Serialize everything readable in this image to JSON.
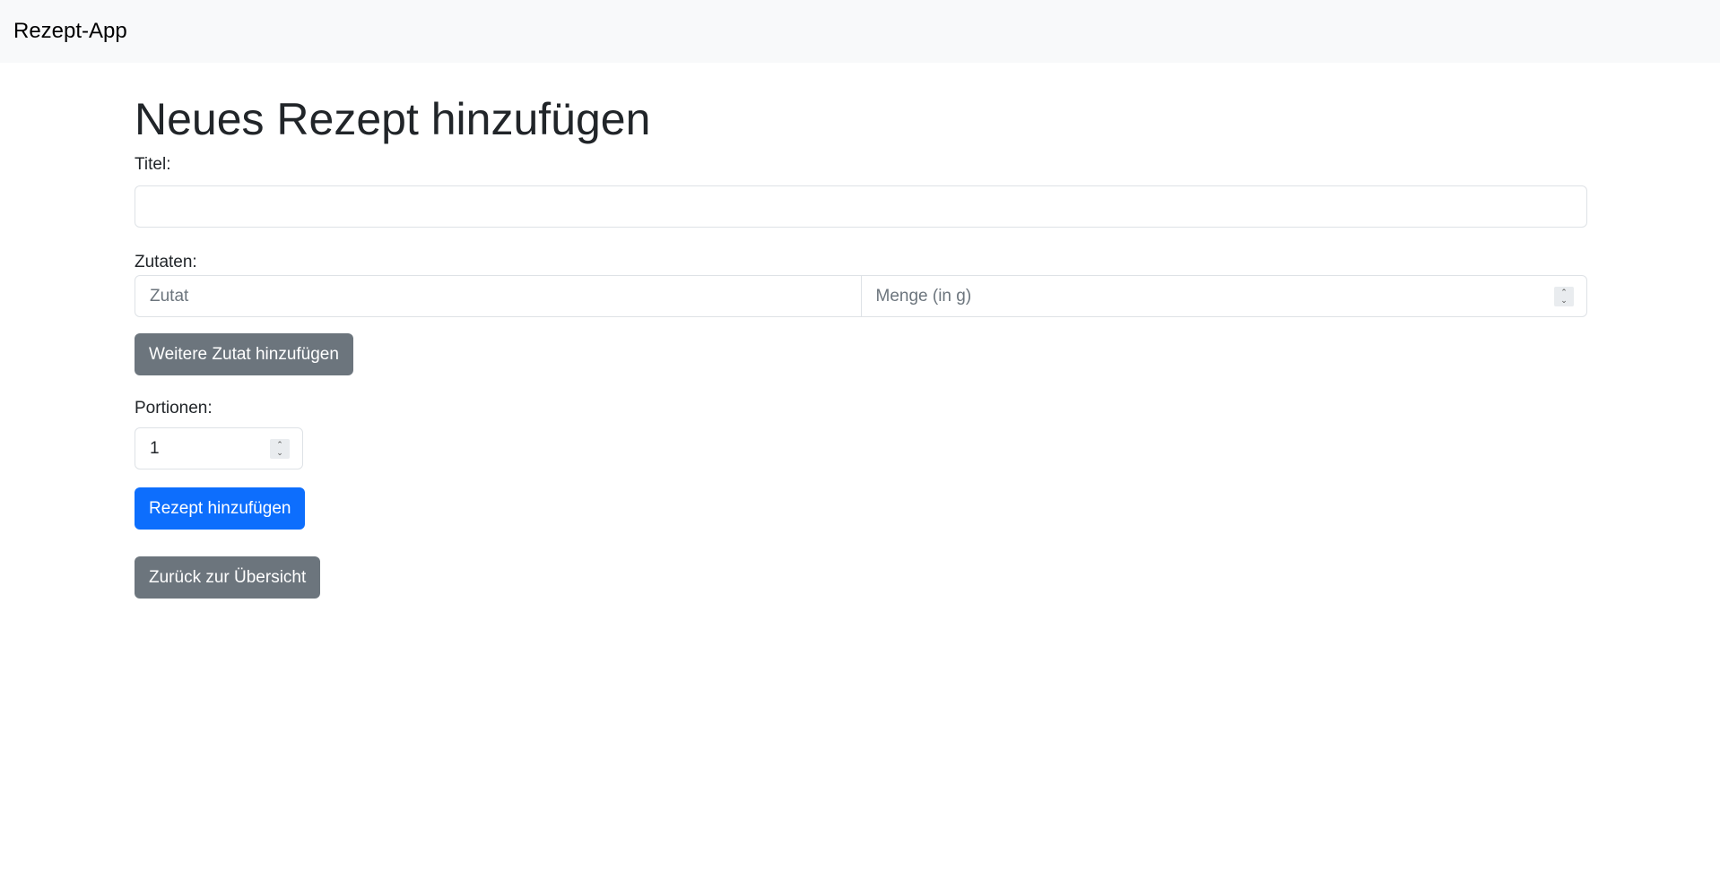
{
  "navbar": {
    "brand": "Rezept-App"
  },
  "page": {
    "title": "Neues Rezept hinzufügen"
  },
  "form": {
    "title_label": "Titel:",
    "title_value": "",
    "ingredients_label": "Zutaten:",
    "ingredient_placeholder": "Zutat",
    "amount_placeholder": "Menge (in g)",
    "add_ingredient_button": "Weitere Zutat hinzufügen",
    "portions_label": "Portionen:",
    "portions_value": "1",
    "submit_button": "Rezept hinzufügen",
    "back_button": "Zurück zur Übersicht"
  },
  "colors": {
    "primary": "#0d6efd",
    "secondary": "#6c757d",
    "navbar_bg": "#f8f9fa"
  },
  "icons": {
    "spinner_up": "chevron-up-icon",
    "spinner_down": "chevron-down-icon"
  }
}
